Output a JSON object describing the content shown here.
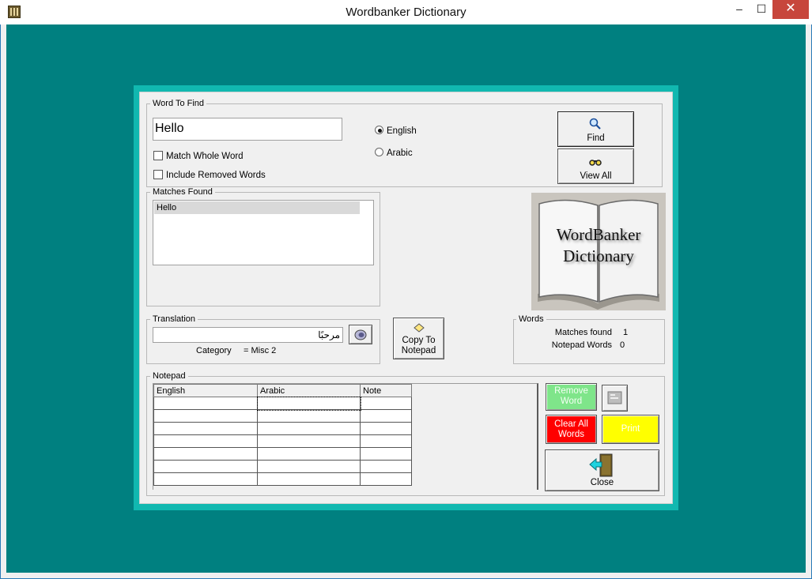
{
  "window": {
    "title": "Wordbanker Dictionary",
    "min_glyph": "–",
    "max_glyph": "☐",
    "close_glyph": "✕"
  },
  "word_to_find": {
    "group_label": "Word To Find",
    "value": "Hello",
    "match_whole_word": {
      "label": "Match Whole Word",
      "checked": false
    },
    "include_removed_words": {
      "label": "Include Removed Words",
      "checked": false
    },
    "language": {
      "options": [
        "English",
        "Arabic"
      ],
      "selected": "English"
    },
    "find_label": "Find",
    "view_all_label": "View All"
  },
  "matches_found": {
    "group_label": "Matches Found",
    "items": [
      "Hello"
    ],
    "selected_index": 0
  },
  "logo": {
    "line1": "WordBanker",
    "line2": "Dictionary"
  },
  "translation": {
    "group_label": "Translation",
    "value": "مرحبًا",
    "category_label": "Category",
    "category_value": "= Misc 2"
  },
  "copy_to_notepad": {
    "line1": "Copy To",
    "line2": "Notepad"
  },
  "words": {
    "group_label": "Words",
    "matches_found_label": "Matches found",
    "matches_found_value": "1",
    "notepad_words_label": "Notepad Words",
    "notepad_words_value": "0"
  },
  "notepad": {
    "group_label": "Notepad",
    "columns": [
      "English",
      "Arabic",
      "Note"
    ],
    "row_count": 7
  },
  "actions": {
    "remove_word": {
      "line1": "Remove",
      "line2": "Word"
    },
    "clear_all_words": {
      "line1": "Clear All",
      "line2": "Words"
    },
    "print_label": "Print",
    "close_label": "Close"
  },
  "colors": {
    "client_bg": "#008080",
    "panel_border": "#11b8b0",
    "remove_word_bg": "#7fe58a",
    "clear_all_bg": "#ff0000",
    "print_bg": "#ffff00"
  }
}
